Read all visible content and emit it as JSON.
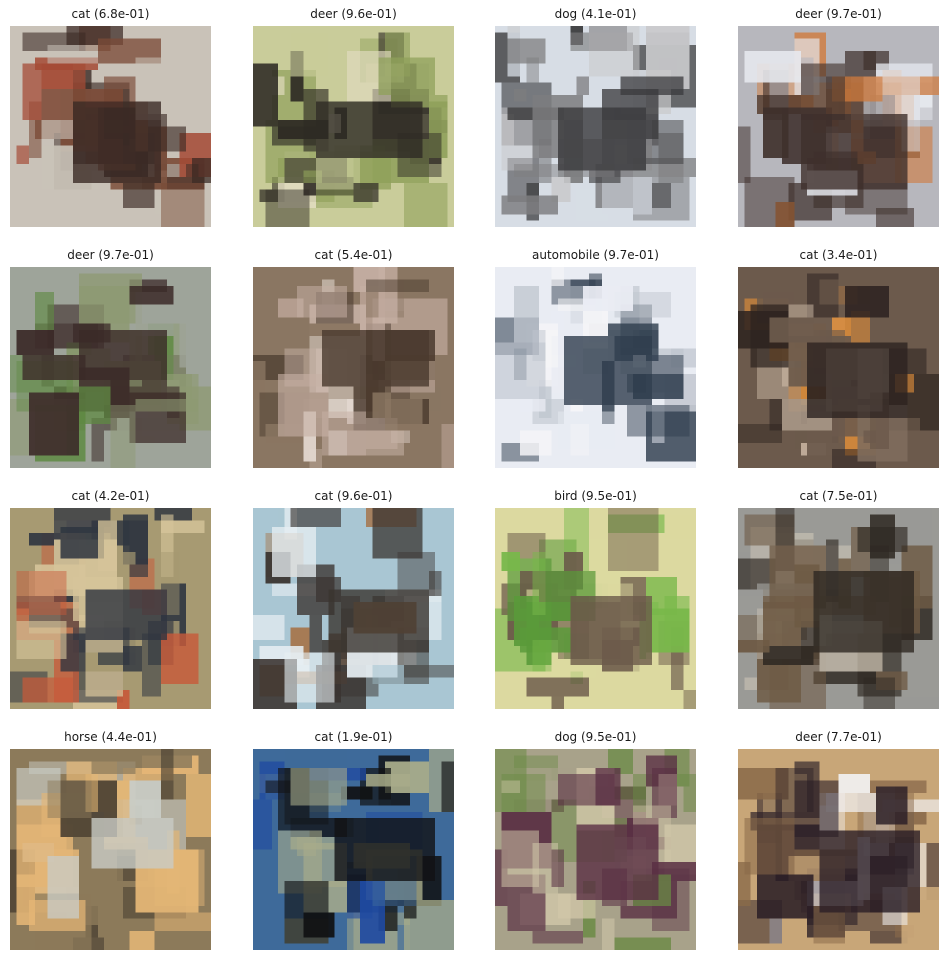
{
  "figure": {
    "background": "#ffffff",
    "rows": 4,
    "cols": 4,
    "panels": [
      {
        "label": "cat (6.8e-01)",
        "scene": [
          "#c9c2b8",
          "#7a4a36",
          "#3b2a25",
          "#a44a35"
        ]
      },
      {
        "label": "deer (9.6e-01)",
        "scene": [
          "#c9cc9a",
          "#8fa05a",
          "#2e2a24",
          "#e2dcc0"
        ]
      },
      {
        "label": "dog (4.1e-01)",
        "scene": [
          "#d7dde5",
          "#7d7d7f",
          "#3a3a3c",
          "#c9c9cb"
        ]
      },
      {
        "label": "deer (9.7e-01)",
        "scene": [
          "#b7b7bd",
          "#d07a3c",
          "#3f302c",
          "#e6e8ee"
        ]
      },
      {
        "label": "deer (9.7e-01)",
        "scene": [
          "#9ea49a",
          "#8e9a72",
          "#3b2a28",
          "#5f8a43"
        ]
      },
      {
        "label": "cat (5.4e-01)",
        "scene": [
          "#8a7662",
          "#c6b0a4",
          "#4a3a2e",
          "#e3d8d0"
        ]
      },
      {
        "label": "automobile (9.7e-01)",
        "scene": [
          "#e9ecf3",
          "#bfc5ce",
          "#2f3d4e",
          "#f5f5f7"
        ]
      },
      {
        "label": "cat (3.4e-01)",
        "scene": [
          "#6c5a4c",
          "#d88a3a",
          "#2d2320",
          "#c9b6a2"
        ]
      },
      {
        "label": "cat (4.2e-01)",
        "scene": [
          "#a79a72",
          "#d6c49a",
          "#2f3540",
          "#c75a3a"
        ]
      },
      {
        "label": "cat (9.6e-01)",
        "scene": [
          "#a9c6d3",
          "#a6744a",
          "#3a3430",
          "#e6eef2"
        ]
      },
      {
        "label": "bird (9.5e-01)",
        "scene": [
          "#dcd9a0",
          "#78b84a",
          "#6b5a4a",
          "#5a9a3a"
        ]
      },
      {
        "label": "cat (7.5e-01)",
        "scene": [
          "#9a9a96",
          "#6e5a44",
          "#2e2822",
          "#c9c2b4"
        ]
      },
      {
        "label": "horse (4.4e-01)",
        "scene": [
          "#8c7a5a",
          "#e4b676",
          "#c9ccc6",
          "#4a4032"
        ]
      },
      {
        "label": "cat (1.9e-01)",
        "scene": [
          "#3e6a9a",
          "#a8ac8a",
          "#111214",
          "#1f4aa0"
        ]
      },
      {
        "label": "dog (9.5e-01)",
        "scene": [
          "#a8a28a",
          "#6a8a44",
          "#5a3044",
          "#d0c6a8"
        ]
      },
      {
        "label": "deer (7.7e-01)",
        "scene": [
          "#c8a678",
          "#f0eeee",
          "#2a1e26",
          "#8a6a4a"
        ]
      }
    ]
  }
}
